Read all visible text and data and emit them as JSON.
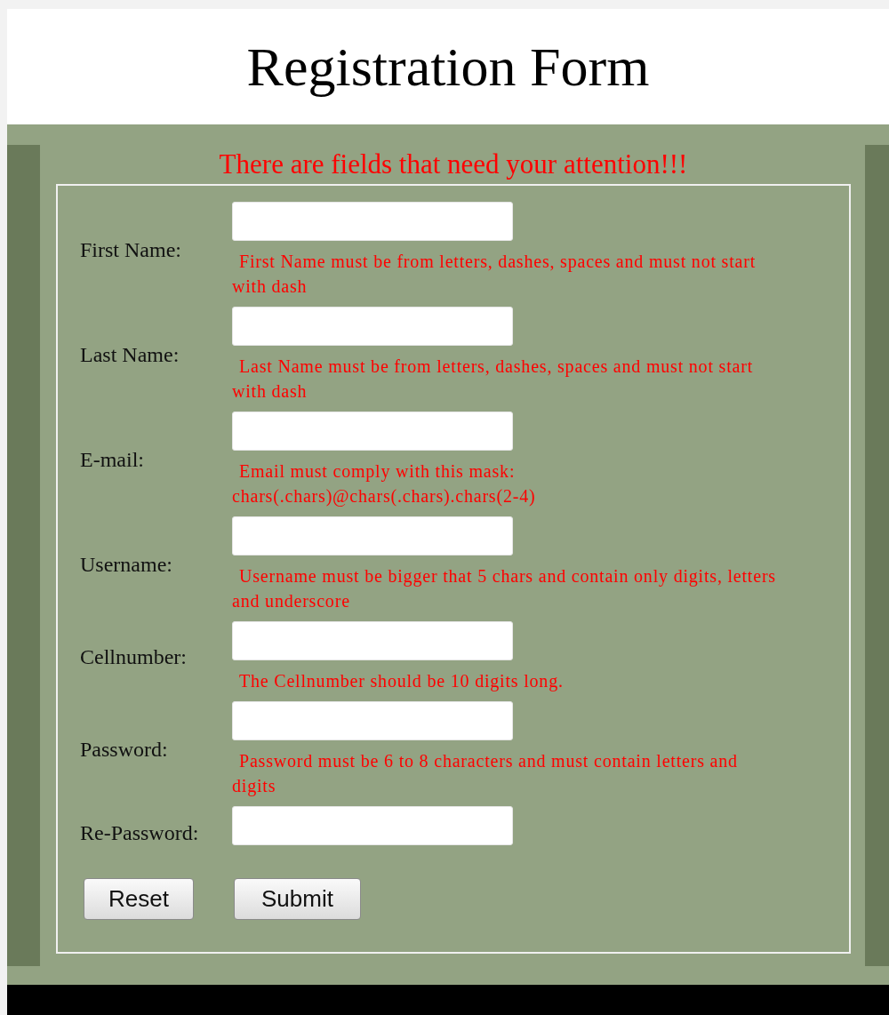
{
  "title": "Registration Form",
  "warning": "There are fields that need your attention!!!",
  "fields": [
    {
      "label": "First Name:",
      "error": "First Name must be from letters, dashes, spaces and must not start with dash"
    },
    {
      "label": "Last Name:",
      "error": "Last Name must be from letters, dashes, spaces and must not start with dash"
    },
    {
      "label": "E-mail:",
      "error": "Email must comply with this mask: chars(.chars)@chars(.chars).chars(2-4)"
    },
    {
      "label": "Username:",
      "error": "Username must be bigger that 5 chars and contain only digits, letters and underscore"
    },
    {
      "label": "Cellnumber:",
      "error": "The Cellnumber should be 10 digits long."
    },
    {
      "label": "Password:",
      "error": "Password must be 6 to 8 characters and must contain letters and digits"
    },
    {
      "label": "Re-Password:"
    }
  ],
  "buttons": [
    {
      "label": "Reset",
      "kind": "reset"
    },
    {
      "label": "Submit",
      "kind": "submit"
    }
  ]
}
